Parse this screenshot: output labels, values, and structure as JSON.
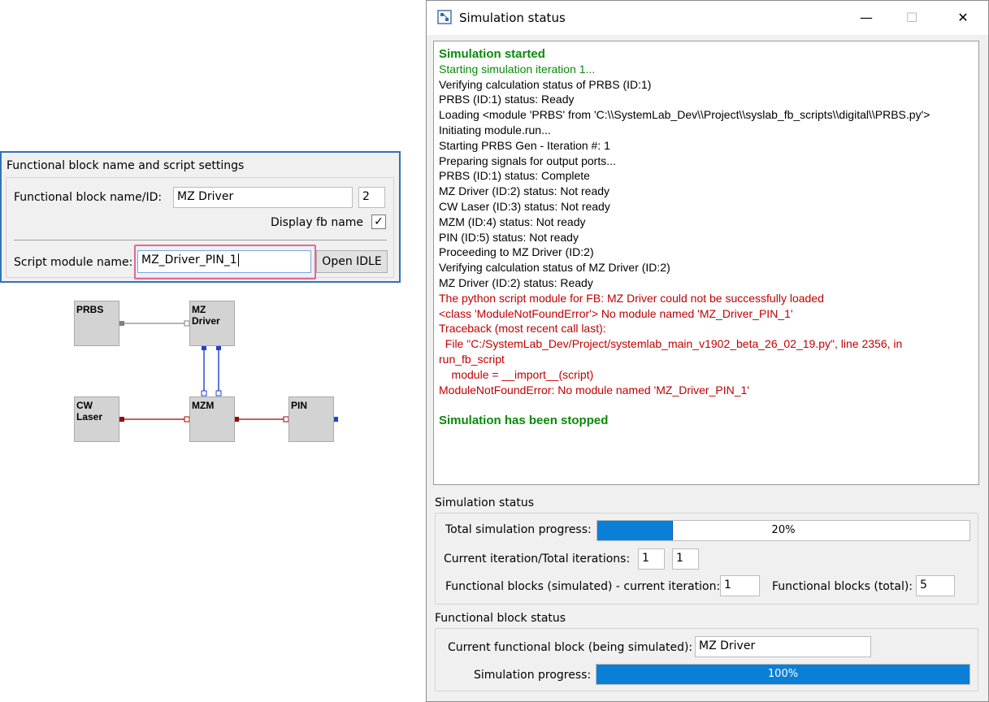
{
  "settings_panel": {
    "title": "Functional block name and script settings",
    "name_label": "Functional block name/ID:",
    "name_value": "MZ Driver",
    "id_value": "2",
    "display_label": "Display fb name",
    "display_checked": "✓",
    "script_label": "Script module name:",
    "script_value": "MZ_Driver_PIN_1",
    "open_idle_label": "Open IDLE"
  },
  "diagram": {
    "blocks": {
      "prbs": "PRBS",
      "mz_driver": "MZ\nDriver",
      "cw_laser": "CW\nLaser",
      "mzm": "MZM",
      "pin": "PIN"
    },
    "colors": {
      "electrical": "#1f3fd8",
      "optical": "#a00000",
      "binary": "#808080"
    }
  },
  "window": {
    "title": "Simulation status",
    "minimize": "—",
    "maximize": "☐",
    "close": "✕"
  },
  "log": [
    {
      "text": "Simulation started",
      "style": "green bold"
    },
    {
      "text": "Starting simulation iteration 1...",
      "style": "green"
    },
    {
      "text": "Verifying calculation status of PRBS (ID:1)",
      "style": "black"
    },
    {
      "text": "PRBS (ID:1) status: Ready",
      "style": "black"
    },
    {
      "text": "Loading <module 'PRBS' from 'C:\\\\SystemLab_Dev\\\\Project\\\\syslab_fb_scripts\\\\digital\\\\PRBS.py'>",
      "style": "black"
    },
    {
      "text": "Initiating module.run...",
      "style": "black"
    },
    {
      "text": "Starting PRBS Gen - Iteration #: 1",
      "style": "black"
    },
    {
      "text": "Preparing signals for output ports...",
      "style": "black"
    },
    {
      "text": "PRBS (ID:1) status: Complete",
      "style": "black"
    },
    {
      "text": "MZ Driver (ID:2) status: Not ready",
      "style": "black"
    },
    {
      "text": "CW Laser (ID:3) status: Not ready",
      "style": "black"
    },
    {
      "text": "MZM (ID:4) status: Not ready",
      "style": "black"
    },
    {
      "text": "PIN (ID:5) status: Not ready",
      "style": "black"
    },
    {
      "text": "Proceeding to MZ Driver (ID:2)",
      "style": "black"
    },
    {
      "text": "Verifying calculation status of MZ Driver (ID:2)",
      "style": "black"
    },
    {
      "text": "MZ Driver (ID:2) status: Ready",
      "style": "black"
    },
    {
      "text": "The python script module for FB: MZ Driver could not be successfully loaded",
      "style": "red"
    },
    {
      "text": "<class 'ModuleNotFoundError'> No module named 'MZ_Driver_PIN_1'",
      "style": "red"
    },
    {
      "text": "Traceback (most recent call last):",
      "style": "red"
    },
    {
      "text": "  File \"C:/SystemLab_Dev/Project/systemlab_main_v1902_beta_26_02_19.py\", line 2356, in",
      "style": "red"
    },
    {
      "text": "run_fb_script",
      "style": "red"
    },
    {
      "text": "    module = __import__(script)",
      "style": "red"
    },
    {
      "text": "ModuleNotFoundError: No module named 'MZ_Driver_PIN_1'",
      "style": "red"
    },
    {
      "text": "",
      "style": "black"
    },
    {
      "text": "Simulation has been stopped",
      "style": "green bold"
    }
  ],
  "sim_status": {
    "section_title": "Simulation status",
    "total_progress_label": "Total simulation progress:",
    "total_progress_text": "20%",
    "total_progress_fraction": 0.2,
    "iteration_label": "Current iteration/Total iterations:",
    "current_iteration": "1",
    "total_iterations": "1",
    "fb_simulated_label": "Functional blocks (simulated) - current iteration:",
    "fb_simulated_value": "1",
    "fb_total_label": "Functional blocks (total):",
    "fb_total_value": "5"
  },
  "fb_status": {
    "section_title": "Functional block status",
    "current_fb_label": "Current functional block (being simulated):",
    "current_fb_value": "MZ Driver",
    "sim_progress_label": "Simulation progress:",
    "sim_progress_text": "100%",
    "sim_progress_fraction": 1.0
  }
}
